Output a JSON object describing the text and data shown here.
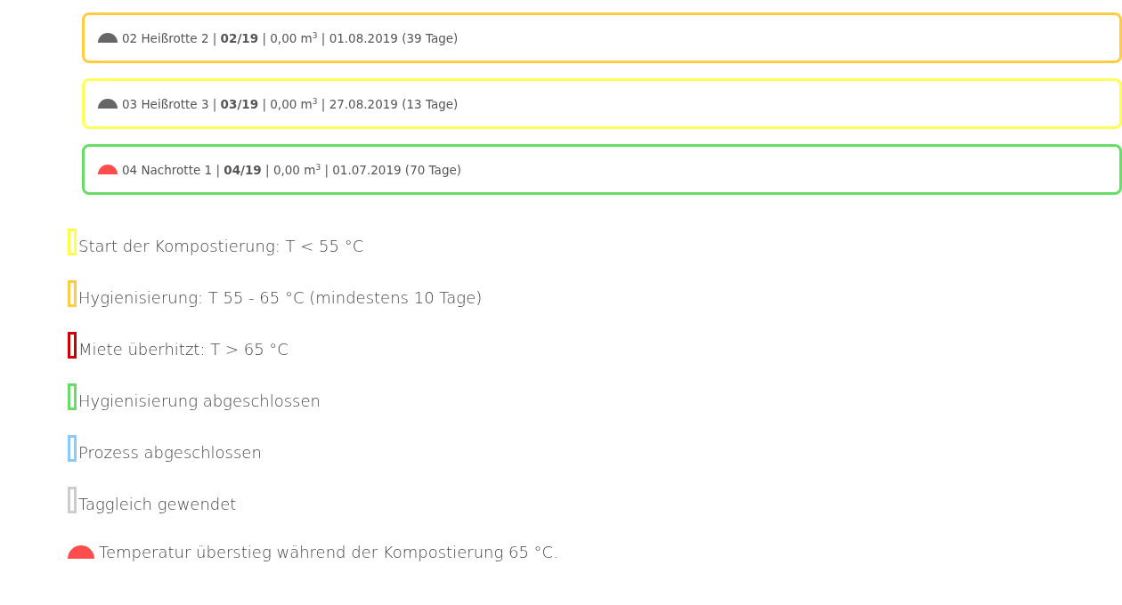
{
  "piles": [
    {
      "text": "02 Heißrotte 2 | **02/19** | 0,00 m$^{3}$ | 01.08.2019 (39 Tage)",
      "color": "#ffcc44",
      "overheated": false
    },
    {
      "text": "03 Heißrotte 3 | **03/19** | 0,00 m$^{3}$ | 27.08.2019 (13 Tage)",
      "color": "#ffff55",
      "overheated": false
    },
    {
      "text": "04 Nachrotte 1 | **04/19** | 0,00 m$^{3}$ | 01.07.2019 (70 Tage)",
      "color": "#66dd66",
      "overheated": true
    }
  ],
  "legend": [
    {
      "kind": "swatch",
      "color": "#ffff44",
      "label": "Start der Kompostierung: T < 55 °C"
    },
    {
      "kind": "swatch",
      "color": "#ffcc44",
      "label": "Hygienisierung: T 55 - 65 °C (mindestens 10 Tage)"
    },
    {
      "kind": "swatch",
      "color": "#cc0000",
      "label": "Miete überhitzt: T > 65 °C"
    },
    {
      "kind": "swatch",
      "color": "#66dd66",
      "label": "Hygienisierung abgeschlossen"
    },
    {
      "kind": "swatch",
      "color": "#88ccff",
      "label": "Prozess abgeschlossen"
    },
    {
      "kind": "swatch",
      "color": "#cccccc",
      "label": "Taggleich gewendet"
    },
    {
      "kind": "dome",
      "label": "Temperatur überstieg während der Kompostierung 65 °C."
    }
  ]
}
